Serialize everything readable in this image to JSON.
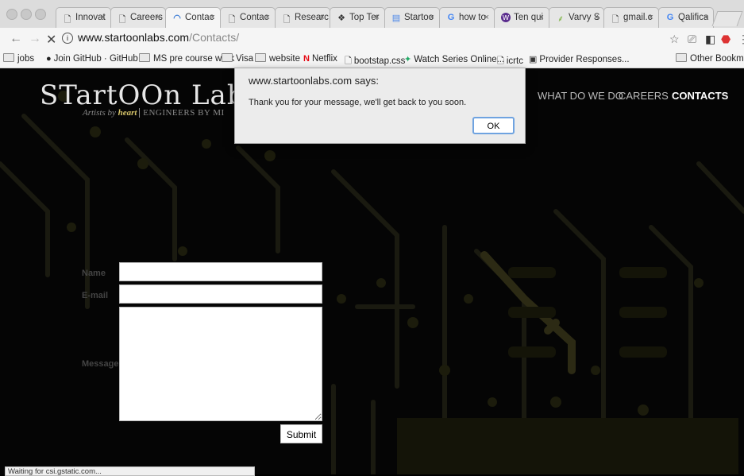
{
  "browser": {
    "tabs": [
      {
        "icon": "doc-icon",
        "glyph": "🗋",
        "label": "Innovat"
      },
      {
        "icon": "doc-icon",
        "glyph": "🗋",
        "label": "Careers"
      },
      {
        "icon": "loading-icon",
        "glyph": "◠",
        "label": "Contac"
      },
      {
        "icon": "doc-icon",
        "glyph": "🗋",
        "label": "Contac"
      },
      {
        "icon": "doc-icon",
        "glyph": "🗋",
        "label": "Researc"
      },
      {
        "icon": "toptal-icon",
        "glyph": "❖",
        "label": "Top Ter"
      },
      {
        "icon": "docs-icon",
        "glyph": "▤",
        "label": "Startoo"
      },
      {
        "icon": "google-icon",
        "glyph": "G",
        "label": "how to"
      },
      {
        "icon": "w-icon",
        "glyph": "w",
        "label": "Ten qui"
      },
      {
        "icon": "leaf-icon",
        "glyph": "⸙",
        "label": "Varvy S"
      },
      {
        "icon": "doc-icon",
        "glyph": "🗋",
        "label": "gmail.c"
      },
      {
        "icon": "google-icon",
        "glyph": "G",
        "label": "Qalifica"
      }
    ],
    "tab_close": "×",
    "url_host": "www.startoonlabs.com",
    "url_path": "/Contacts/",
    "bookmarks": [
      {
        "label": "jobs",
        "icon": "folder-icon"
      },
      {
        "label": "Join GitHub · GitHub",
        "icon": "github-icon",
        "glyph": "●"
      },
      {
        "label": "MS pre course work",
        "icon": "folder-icon"
      },
      {
        "label": "Visa",
        "icon": "folder-icon"
      },
      {
        "label": "website",
        "icon": "folder-icon"
      },
      {
        "label": "Netflix",
        "icon": "netflix-icon",
        "glyph": "N"
      },
      {
        "label": "bootstap.css",
        "icon": "doc-icon",
        "glyph": "🗋"
      },
      {
        "label": "Watch Series Online...",
        "icon": "watchseries-icon",
        "glyph": "✦"
      },
      {
        "label": "icrtc",
        "icon": "doc-icon",
        "glyph": "🗋"
      },
      {
        "label": "Provider Responses...",
        "icon": "uc-icon",
        "glyph": "▣"
      }
    ],
    "other_bookmarks": "Other Bookmarks",
    "status": "Waiting for csi.gstatic.com..."
  },
  "site": {
    "logo": "STartOOn Labs",
    "tagline_prefix": "Artists by",
    "tagline_heart": "heart",
    "tagline_eng": "ENGINEERS BY MI",
    "nav": [
      {
        "label": "WHAT DO WE DO",
        "active": false
      },
      {
        "label": "CAREERS",
        "active": false
      },
      {
        "label": "CONTACTS",
        "active": true
      }
    ],
    "form": {
      "name_label": "Name",
      "email_label": "E-mail",
      "message_label": "Message",
      "name_value": "",
      "email_value": "",
      "message_value": "",
      "submit_label": "Submit"
    }
  },
  "dialog": {
    "title": "www.startoonlabs.com says:",
    "message": "Thank you for your message, we'll get back to you soon.",
    "ok_label": "OK"
  }
}
